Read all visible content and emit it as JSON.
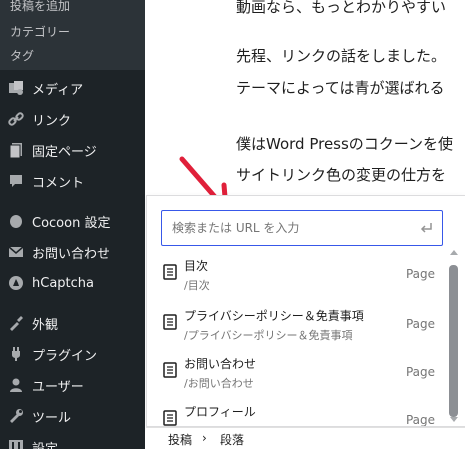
{
  "sidebar": {
    "submenu": [
      "投稿を追加",
      "カテゴリー",
      "タグ"
    ],
    "items": [
      {
        "label": "メディア",
        "icon": "media-icon"
      },
      {
        "label": "リンク",
        "icon": "link-icon"
      },
      {
        "label": "固定ページ",
        "icon": "page-icon"
      },
      {
        "label": "コメント",
        "icon": "comment-icon"
      },
      {
        "label": "Cocoon 設定",
        "icon": "cocoon-icon"
      },
      {
        "label": "お問い合わせ",
        "icon": "mail-icon"
      },
      {
        "label": "hCaptcha",
        "icon": "hcaptcha-icon"
      },
      {
        "label": "外観",
        "icon": "appearance-icon"
      },
      {
        "label": "プラグイン",
        "icon": "plugin-icon"
      },
      {
        "label": "ユーザー",
        "icon": "user-icon"
      },
      {
        "label": "ツール",
        "icon": "tools-icon"
      },
      {
        "label": "設定",
        "icon": "settings-icon"
      }
    ]
  },
  "content": {
    "lines": [
      "動画なら、もっとわかりやすい",
      "先程、リンクの話をしました。",
      "テーマによっては青が選ばれる",
      "僕はWord Pressのコクーンを使",
      "サイトリンク色の変更の仕方を"
    ]
  },
  "link_popover": {
    "search_placeholder": "検索または URL を入力",
    "results": [
      {
        "title": "目次",
        "path": "/目次",
        "type": "Page"
      },
      {
        "title": "プライバシーポリシー＆免責事項",
        "path": "/プライバシーポリシー＆免責事項",
        "type": "Page"
      },
      {
        "title": "お問い合わせ",
        "path": "/お問い合わせ",
        "type": "Page"
      },
      {
        "title": "プロフィール",
        "path": "",
        "type": "Page"
      }
    ]
  },
  "breadcrumb": {
    "root": "投稿",
    "separator": "›",
    "current": "段落"
  },
  "colors": {
    "sidebar_bg": "#1d2327",
    "accent": "#3858e9",
    "arrow": "#e0203a"
  }
}
